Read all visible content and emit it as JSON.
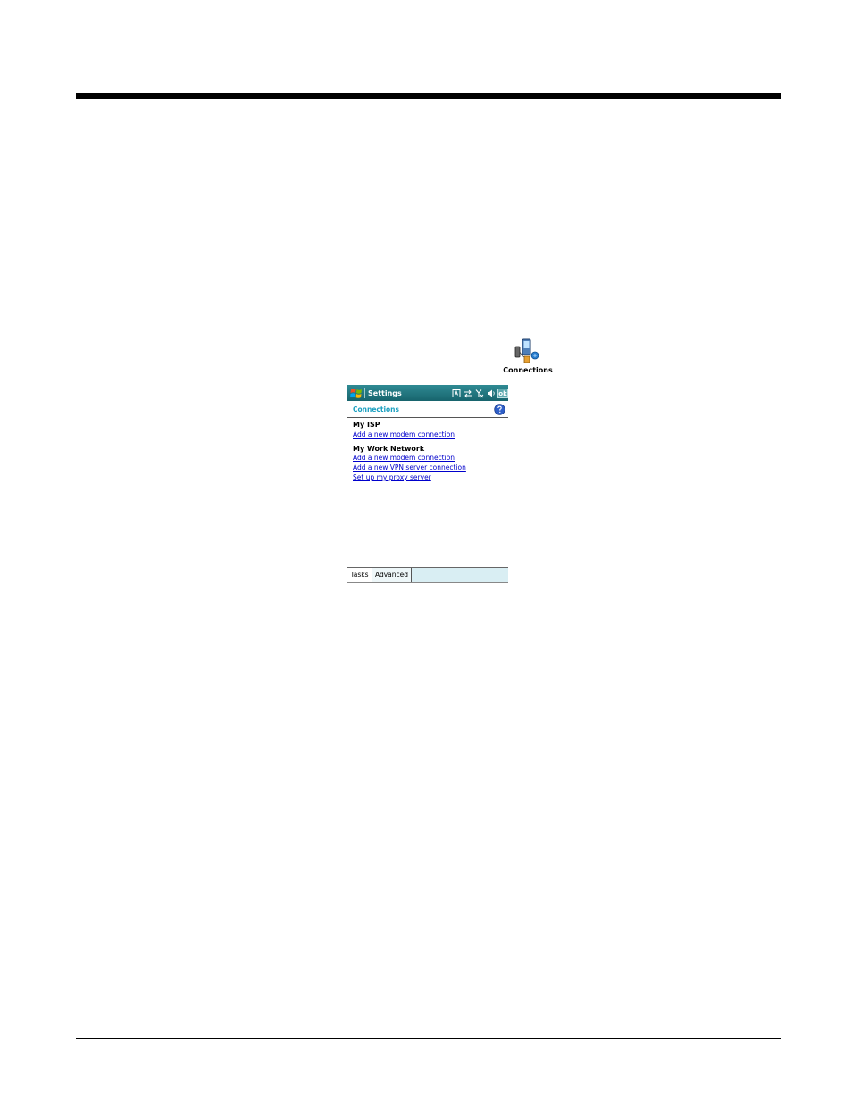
{
  "desktop_icon": {
    "label": "Connections",
    "icon": "connections-icon"
  },
  "window": {
    "title": "Settings",
    "ok_label": "ok",
    "tray_icons": [
      "input-panel-icon",
      "sync-arrows-icon",
      "signal-off-icon",
      "speaker-icon"
    ]
  },
  "page": {
    "section_title": "Connections",
    "groups": [
      {
        "heading": "My ISP",
        "links": [
          "Add a new modem connection"
        ]
      },
      {
        "heading": "My Work Network",
        "links": [
          "Add a new modem connection",
          "Add a new VPN server connection",
          "Set up my proxy server"
        ]
      }
    ]
  },
  "tabs": [
    {
      "label": "Tasks",
      "active": true
    },
    {
      "label": "Advanced",
      "active": false
    }
  ],
  "colors": {
    "titlebar": "#17646d",
    "section_title": "#1ba0c0",
    "link": "#0000cc",
    "tabbar": "#d9eef3"
  }
}
